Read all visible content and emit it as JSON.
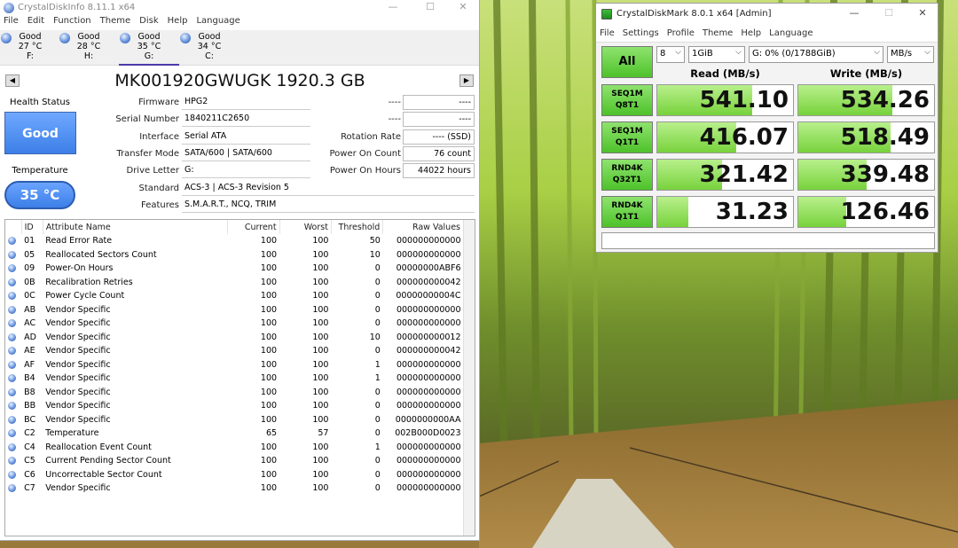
{
  "cdi": {
    "title": "CrystalDiskInfo 8.11.1 x64",
    "menu": [
      "File",
      "Edit",
      "Function",
      "Theme",
      "Disk",
      "Help",
      "Language"
    ],
    "disks": [
      {
        "status": "Good",
        "temp": "27 °C",
        "letter": "F:"
      },
      {
        "status": "Good",
        "temp": "28 °C",
        "letter": "H:"
      },
      {
        "status": "Good",
        "temp": "35 °C",
        "letter": "G:"
      },
      {
        "status": "Good",
        "temp": "34 °C",
        "letter": "C:"
      }
    ],
    "disk_title": "MK001920GWUGK 1920.3 GB",
    "health_label": "Health Status",
    "health_value": "Good",
    "temp_label": "Temperature",
    "temp_value": "35 °C",
    "fields": {
      "firmware_label": "Firmware",
      "firmware": "HPG2",
      "serial_label": "Serial Number",
      "serial": "1840211C2650",
      "interface_label": "Interface",
      "interface": "Serial ATA",
      "transfer_label": "Transfer Mode",
      "transfer": "SATA/600 | SATA/600",
      "letter_label": "Drive Letter",
      "letter": "G:",
      "standard_label": "Standard",
      "standard": "ACS-3 | ACS-3 Revision 5",
      "features_label": "Features",
      "features": "S.M.A.R.T., NCQ, TRIM",
      "right1_label": "----",
      "right1": "----",
      "right2_label": "----",
      "right2": "----",
      "rotation_label": "Rotation Rate",
      "rotation": "---- (SSD)",
      "poweron_count_label": "Power On Count",
      "poweron_count": "76 count",
      "poweron_hours_label": "Power On Hours",
      "poweron_hours": "44022 hours"
    },
    "smart_headers": [
      "ID",
      "Attribute Name",
      "Current",
      "Worst",
      "Threshold",
      "Raw Values"
    ],
    "smart_rows": [
      [
        "01",
        "Read Error Rate",
        "100",
        "100",
        "50",
        "000000000000"
      ],
      [
        "05",
        "Reallocated Sectors Count",
        "100",
        "100",
        "10",
        "000000000000"
      ],
      [
        "09",
        "Power-On Hours",
        "100",
        "100",
        "0",
        "00000000ABF6"
      ],
      [
        "0B",
        "Recalibration Retries",
        "100",
        "100",
        "0",
        "000000000042"
      ],
      [
        "0C",
        "Power Cycle Count",
        "100",
        "100",
        "0",
        "00000000004C"
      ],
      [
        "AB",
        "Vendor Specific",
        "100",
        "100",
        "0",
        "000000000000"
      ],
      [
        "AC",
        "Vendor Specific",
        "100",
        "100",
        "0",
        "000000000000"
      ],
      [
        "AD",
        "Vendor Specific",
        "100",
        "100",
        "10",
        "000000000012"
      ],
      [
        "AE",
        "Vendor Specific",
        "100",
        "100",
        "0",
        "000000000042"
      ],
      [
        "AF",
        "Vendor Specific",
        "100",
        "100",
        "1",
        "000000000000"
      ],
      [
        "B4",
        "Vendor Specific",
        "100",
        "100",
        "1",
        "000000000000"
      ],
      [
        "B8",
        "Vendor Specific",
        "100",
        "100",
        "0",
        "000000000000"
      ],
      [
        "BB",
        "Vendor Specific",
        "100",
        "100",
        "0",
        "000000000000"
      ],
      [
        "BC",
        "Vendor Specific",
        "100",
        "100",
        "0",
        "0000000000AA"
      ],
      [
        "C2",
        "Temperature",
        "65",
        "57",
        "0",
        "002B000D0023"
      ],
      [
        "C4",
        "Reallocation Event Count",
        "100",
        "100",
        "1",
        "000000000000"
      ],
      [
        "C5",
        "Current Pending Sector Count",
        "100",
        "100",
        "0",
        "000000000000"
      ],
      [
        "C6",
        "Uncorrectable Sector Count",
        "100",
        "100",
        "0",
        "000000000000"
      ],
      [
        "C7",
        "Vendor Specific",
        "100",
        "100",
        "0",
        "000000000000"
      ]
    ]
  },
  "cdm": {
    "title": "CrystalDiskMark 8.0.1 x64 [Admin]",
    "menu": [
      "File",
      "Settings",
      "Profile",
      "Theme",
      "Help",
      "Language"
    ],
    "all_label": "All",
    "count": "8",
    "size": "1GiB",
    "drive": "G: 0% (0/1788GiB)",
    "unit": "MB/s",
    "read_header": "Read (MB/s)",
    "write_header": "Write (MB/s)",
    "tests": [
      {
        "line1": "SEQ1M",
        "line2": "Q8T1",
        "read": "541.10",
        "write": "534.26",
        "read_fill": 0.7,
        "write_fill": 0.69
      },
      {
        "line1": "SEQ1M",
        "line2": "Q1T1",
        "read": "416.07",
        "write": "518.49",
        "read_fill": 0.58,
        "write_fill": 0.68
      },
      {
        "line1": "RND4K",
        "line2": "Q32T1",
        "read": "321.42",
        "write": "339.48",
        "read_fill": 0.48,
        "write_fill": 0.5
      },
      {
        "line1": "RND4K",
        "line2": "Q1T1",
        "read": "31.23",
        "write": "126.46",
        "read_fill": 0.23,
        "write_fill": 0.35
      }
    ]
  }
}
